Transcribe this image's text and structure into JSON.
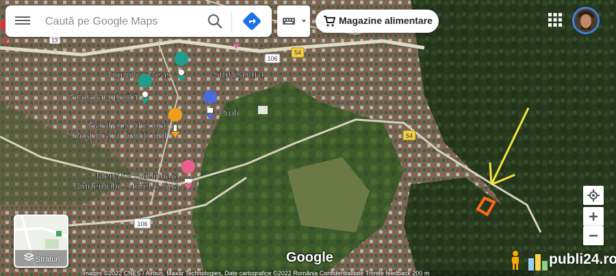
{
  "search": {
    "placeholder": "Caută pe Google Maps"
  },
  "category_chip": {
    "label": "Magazine alimentare",
    "icon": "cart-icon"
  },
  "map": {
    "city_label": "Sighișoara",
    "road_shields": [
      "106",
      "54",
      "54",
      "106",
      "13"
    ],
    "places": [
      {
        "name": "Turnul cu Ceas",
        "icon": "museum-icon",
        "color": "#1e9f8e"
      },
      {
        "name": "Scara acoperită",
        "icon": "museum-icon",
        "color": "#1e9f8e"
      },
      {
        "name": "Profi",
        "icon": "shopping-icon",
        "color": "#4a6bd8"
      },
      {
        "name_line1": "Gasthaus Altepost",
        "name_line2": "Restaurant Traditional",
        "icon": "restaurant-icon",
        "color": "#f29e1b"
      },
      {
        "name_line1": "Mercure Sighisoara",
        "name_line2": "Binderbubi - Hotel & Spa",
        "icon": "hotel-icon",
        "color": "#e8608c"
      }
    ]
  },
  "annotations": {
    "arrow_color": "#f5e63a",
    "plot_color": "#ff6a1a"
  },
  "layers": {
    "label": "Straturi"
  },
  "google_logo": "Google",
  "attribution": "Imagini ©2022 CNES / Airbus, Maxar Technologies, Date cartografice ©2022   România   Confidențialitate   Trimite feedback   200 m",
  "watermark": {
    "text": "publi24.ro"
  }
}
